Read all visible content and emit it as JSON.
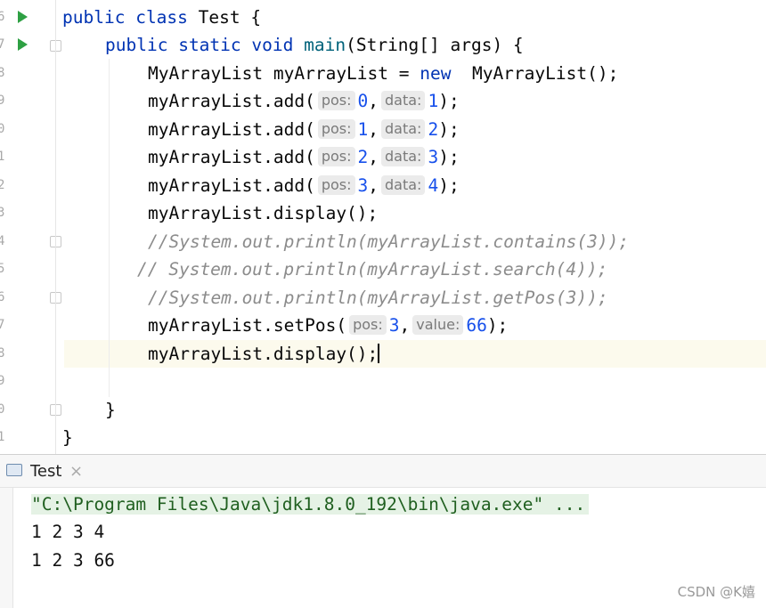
{
  "gutter": {
    "line_numbers": [
      "6",
      "7",
      "8",
      "9",
      "0",
      "1",
      "2",
      "3",
      "4",
      "5",
      "6",
      "7",
      "8",
      "9",
      "0",
      "1"
    ]
  },
  "code": {
    "l1": [
      "public",
      " ",
      "class",
      " Test {"
    ],
    "l2_kw": [
      "public",
      "static",
      "void"
    ],
    "l2_fn": "main",
    "l2_rest": "(String[] args) {",
    "l3_a": "MyArrayList myArrayList = ",
    "l3_new": "new",
    "l3_b": "  MyArrayList();",
    "add_call": "myArrayList.add(",
    "hint_pos": "pos:",
    "hint_data": "data:",
    "hint_value": "value:",
    "comma": ",",
    "close": ");",
    "adds": [
      {
        "pos": "0",
        "data": "1"
      },
      {
        "pos": "1",
        "data": "2"
      },
      {
        "pos": "2",
        "data": "3"
      },
      {
        "pos": "3",
        "data": "4"
      }
    ],
    "display": "myArrayList.display();",
    "comment1": "//System.out.println(myArrayList.contains(3));",
    "comment2": "// System.out.println(myArrayList.search(4));",
    "comment3": "//System.out.println(myArrayList.getPos(3));",
    "setpos_call": "myArrayList.setPos(",
    "setpos_pos": "3",
    "setpos_value": "66",
    "brace_inner": "}",
    "brace_outer": "}"
  },
  "run_panel": {
    "tab_label": "Test",
    "tab_close": "×",
    "command": "\"C:\\Program Files\\Java\\jdk1.8.0_192\\bin\\java.exe\" ...",
    "output": [
      "1 2 3 4",
      "1 2 3 66"
    ],
    "watermark": "CSDN @K嬉"
  },
  "colors": {
    "keyword": "#0033b3",
    "method": "#00627a",
    "number": "#1750eb",
    "comment": "#8c8c8c",
    "run_icon": "#2ea043"
  },
  "icons": [
    "run-icon",
    "fold-icon",
    "console-icon",
    "close-icon"
  ]
}
